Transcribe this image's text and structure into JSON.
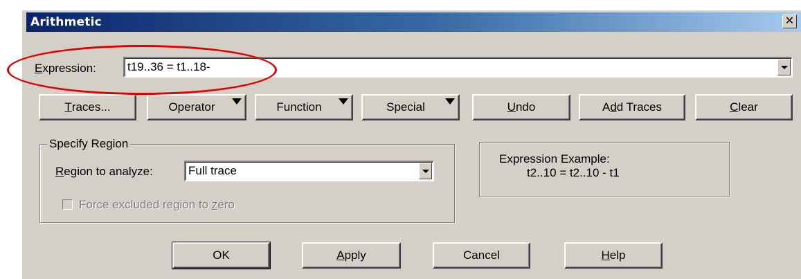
{
  "window": {
    "title": "Arithmetic",
    "close_glyph": "✕"
  },
  "expression": {
    "label_first": "E",
    "label_rest": "xpression:",
    "value": "t19..36 = t1..18-"
  },
  "toolbar": {
    "traces": {
      "u": "T",
      "rest": "races..."
    },
    "operator": "Operator",
    "function": "Function",
    "special": "Special",
    "undo": {
      "u": "U",
      "rest": "ndo"
    },
    "add_traces": {
      "pre": "A",
      "u": "d",
      "rest": "d Traces"
    },
    "clear": {
      "u": "C",
      "rest": "lear"
    }
  },
  "region": {
    "group_title": "Specify Region",
    "label_first": "R",
    "label_rest": "egion to analyze:",
    "selected": "Full trace",
    "force_label_pre": "Force excluded region to ",
    "force_label_u": "z",
    "force_label_rest": "ero",
    "force_checked": false
  },
  "example": {
    "line1": "Expression Example:",
    "line2": "t2..10 = t2..10 - t1"
  },
  "footer": {
    "ok": "OK",
    "apply": {
      "u": "A",
      "rest": "pply"
    },
    "cancel": "Cancel",
    "help": {
      "u": "H",
      "rest": "elp"
    }
  },
  "annotation": {
    "color": "#e00000"
  },
  "colors": {
    "face": "#d4d0c8",
    "title_start": "#0a246a",
    "title_end": "#a6caf0"
  }
}
